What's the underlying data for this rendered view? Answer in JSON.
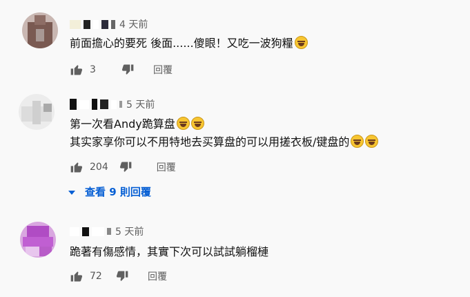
{
  "comments": [
    {
      "time": "4 天前",
      "text": "前面擔心的要死  後面......傻眼！又吃一波狗糧",
      "emoji": [
        "face-with-tears-of-joy"
      ],
      "likes": "3",
      "reply_label": "回覆"
    },
    {
      "time": "5 天前",
      "line1": "第一次看Andy跪算盘",
      "line2": "其实家享你可以不用特地去买算盘的可以用搓衣板/键盘的",
      "emoji": [
        "face-with-tears-of-joy",
        "face-with-tears-of-joy"
      ],
      "likes": "204",
      "reply_label": "回覆",
      "view_replies": "查看 9 則回覆"
    },
    {
      "time": "5 天前",
      "text": "跪著有傷感情，其實下次可以試試躺榴槤",
      "likes": "72",
      "reply_label": "回覆"
    }
  ],
  "icons": {
    "like": "thumbs-up-icon",
    "dislike": "thumbs-down-icon",
    "expand": "caret-down-icon"
  },
  "colors": {
    "link": "#065fd4",
    "icon": "#606060",
    "avatar1": "#7a5a52",
    "avatar3": "#b04cc4"
  }
}
